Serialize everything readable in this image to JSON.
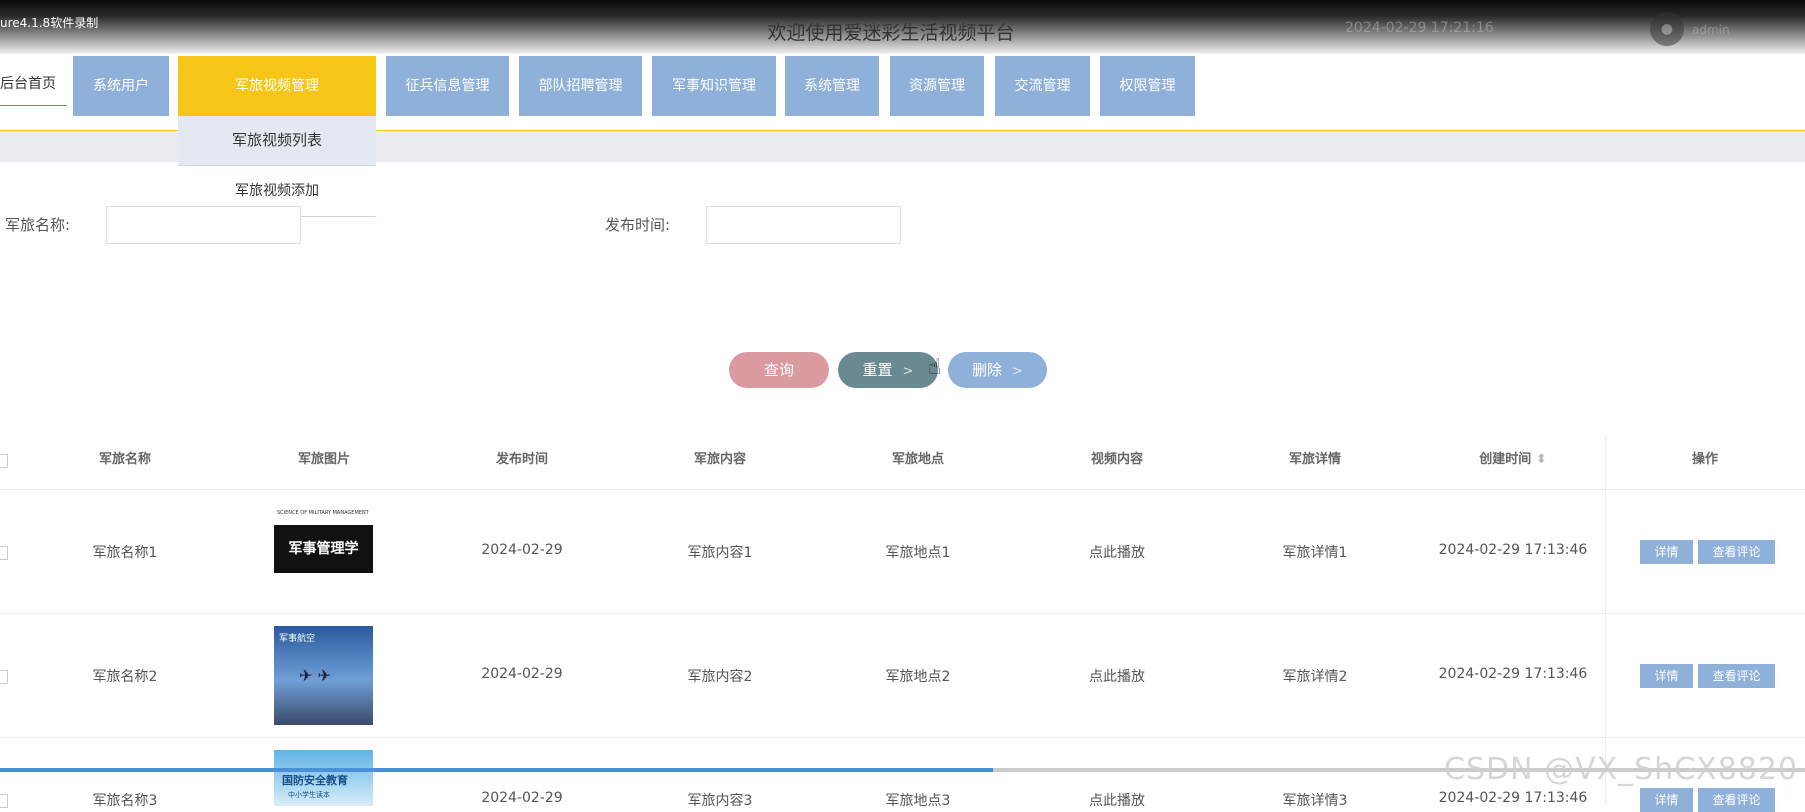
{
  "recording_label": "ure4.1.8软件录制",
  "site_title": "欢迎使用爱迷彩生活视频平台",
  "top_right": {
    "time": "2024-02-29 17:21:16",
    "user": "admin"
  },
  "nav": {
    "home": "后台首页",
    "items": [
      "系统用户",
      "军旅视频管理",
      "征兵信息管理",
      "部队招聘管理",
      "军事知识管理",
      "系统管理",
      "资源管理",
      "交流管理",
      "权限管理"
    ],
    "active_index": 1
  },
  "dropdown": [
    "军旅视频列表",
    "军旅视频添加"
  ],
  "filters": {
    "name_label": "军旅名称:",
    "time_label": "发布时间:"
  },
  "buttons": {
    "query": "查询",
    "reset": "重置",
    "delete": "删除",
    "arrow": ">"
  },
  "table": {
    "headers": [
      "军旅名称",
      "军旅图片",
      "发布时间",
      "军旅内容",
      "军旅地点",
      "视频内容",
      "军旅详情",
      "创建时间",
      "操作"
    ],
    "sort_icon": "⬍",
    "rows": [
      {
        "name": "军旅名称1",
        "date": "2024-02-29",
        "content": "军旅内容1",
        "place": "军旅地点1",
        "video": "点此播放",
        "detail": "军旅详情1",
        "created": "2024-02-29 17:13:46",
        "thumb_title": "军事管理学",
        "thumb_sub": "SCIENCE OF MILITARY MANAGEMENT"
      },
      {
        "name": "军旅名称2",
        "date": "2024-02-29",
        "content": "军旅内容2",
        "place": "军旅地点2",
        "video": "点此播放",
        "detail": "军旅详情2",
        "created": "2024-02-29 17:13:46",
        "thumb_title": "军事航空"
      },
      {
        "name": "军旅名称3",
        "date": "2024-02-29",
        "content": "军旅内容3",
        "place": "军旅地点3",
        "video": "点此播放",
        "detail": "军旅详情3",
        "created": "2024-02-29 17:13:46",
        "thumb_title": "国防安全教育",
        "thumb_sub": "中小学生读本"
      }
    ],
    "actions": {
      "detail": "详情",
      "comments": "查看评论"
    }
  },
  "watermark": "CSDN @VX_ShCX8820",
  "colors": {
    "nav_blue": "#8fb0d9",
    "nav_active": "#f5c518",
    "query": "#d99aa0",
    "reset": "#6a8a91",
    "delete": "#8fb0d9"
  }
}
